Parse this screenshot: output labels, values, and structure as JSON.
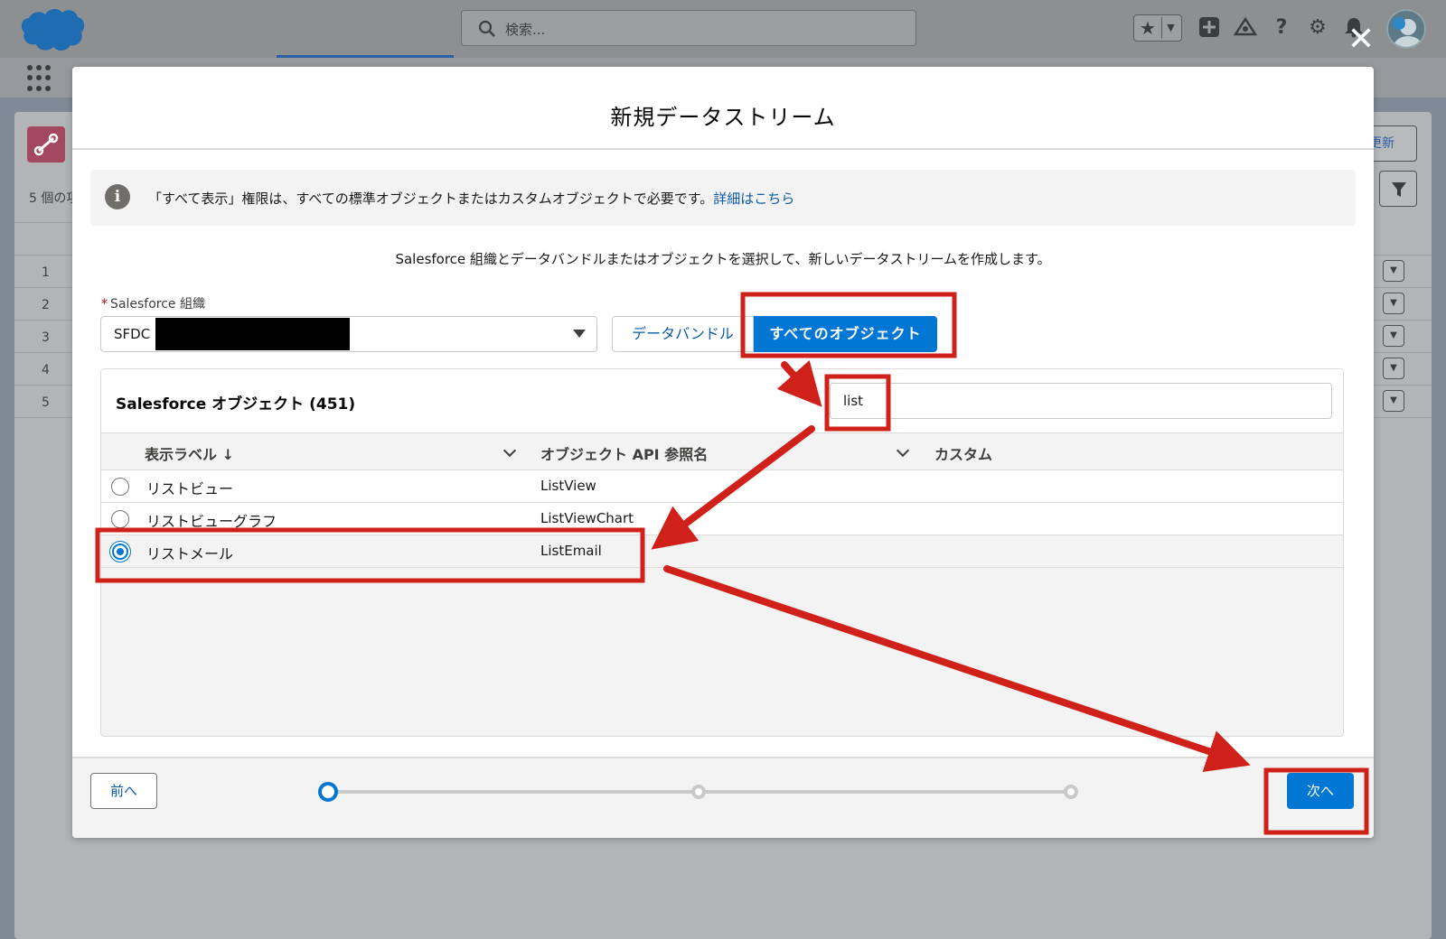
{
  "header": {
    "search_placeholder": "検索...",
    "icons": [
      "star-icon",
      "add-icon",
      "trailhead-icon",
      "help-icon",
      "setup-icon",
      "bell-icon",
      "avatar"
    ]
  },
  "background": {
    "count_text": "5 個の項",
    "row_numbers": [
      "1",
      "2",
      "3",
      "4",
      "5"
    ],
    "update_button": "更新"
  },
  "modal": {
    "title": "新規データストリーム",
    "info_text": "「すべて表示」権限は、すべての標準オブジェクトまたはカスタムオブジェクトで必要です。",
    "info_link": "詳細はこちら",
    "description": "Salesforce 組織とデータバンドルまたはオブジェクトを選択して、新しいデータストリームを作成します。",
    "org_label": "Salesforce 組織",
    "org_required_mark": "*",
    "org_value": "SFDC",
    "source_tabs": {
      "bundle": "データバンドル",
      "all_objects": "すべてのオブジェクト"
    },
    "object_panel": {
      "title": "Salesforce オブジェクト (451)",
      "search_value": "list",
      "columns": {
        "label": "表示ラベル ↓",
        "api": "オブジェクト API 参照名",
        "custom": "カスタム"
      },
      "rows": [
        {
          "label": "リストビュー",
          "api": "ListView",
          "selected": false
        },
        {
          "label": "リストビューグラフ",
          "api": "ListViewChart",
          "selected": false
        },
        {
          "label": "リストメール",
          "api": "ListEmail",
          "selected": true
        }
      ]
    },
    "footer": {
      "prev": "前へ",
      "next": "次へ",
      "current_step": 1,
      "total_steps": 3
    }
  },
  "colors": {
    "brand_blue": "#0176d3",
    "link_blue": "#0b5cab",
    "annotation_red": "#d0201a"
  }
}
